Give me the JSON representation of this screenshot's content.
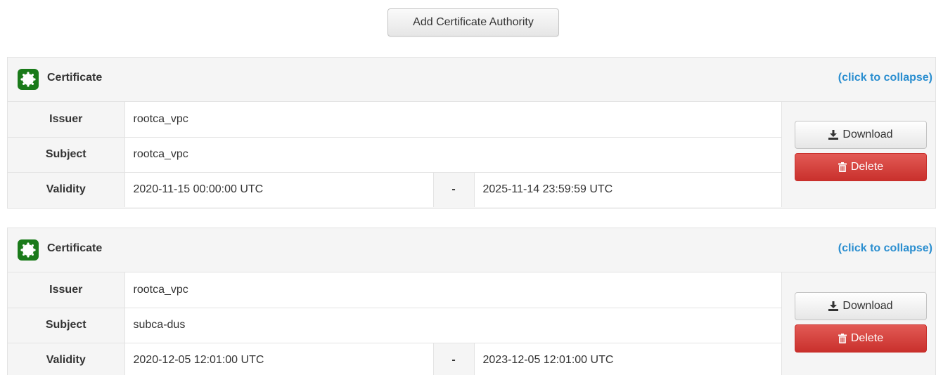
{
  "toolbar": {
    "add_label": "Add Certificate Authority"
  },
  "colors": {
    "accent_link": "#2a8ed0",
    "delete_button": "#d9534f",
    "certificate_icon": "#1a7a1a"
  },
  "certificates": [
    {
      "title": "Certificate",
      "collapse_label": "(click to collapse)",
      "issuer_label": "Issuer",
      "issuer": "rootca_vpc",
      "subject_label": "Subject",
      "subject": "rootca_vpc",
      "validity_label": "Validity",
      "valid_from": "2020-11-15 00:00:00 UTC",
      "separator": "-",
      "valid_to": "2025-11-14 23:59:59 UTC",
      "download_label": "Download",
      "delete_label": "Delete",
      "icons": {
        "certificate": "certificate-icon",
        "download": "download-icon",
        "delete": "trash-icon"
      }
    },
    {
      "title": "Certificate",
      "collapse_label": "(click to collapse)",
      "issuer_label": "Issuer",
      "issuer": "rootca_vpc",
      "subject_label": "Subject",
      "subject": "subca-dus",
      "validity_label": "Validity",
      "valid_from": "2020-12-05 12:01:00 UTC",
      "separator": "-",
      "valid_to": "2023-12-05 12:01:00 UTC",
      "download_label": "Download",
      "delete_label": "Delete",
      "icons": {
        "certificate": "certificate-icon",
        "download": "download-icon",
        "delete": "trash-icon"
      }
    }
  ]
}
